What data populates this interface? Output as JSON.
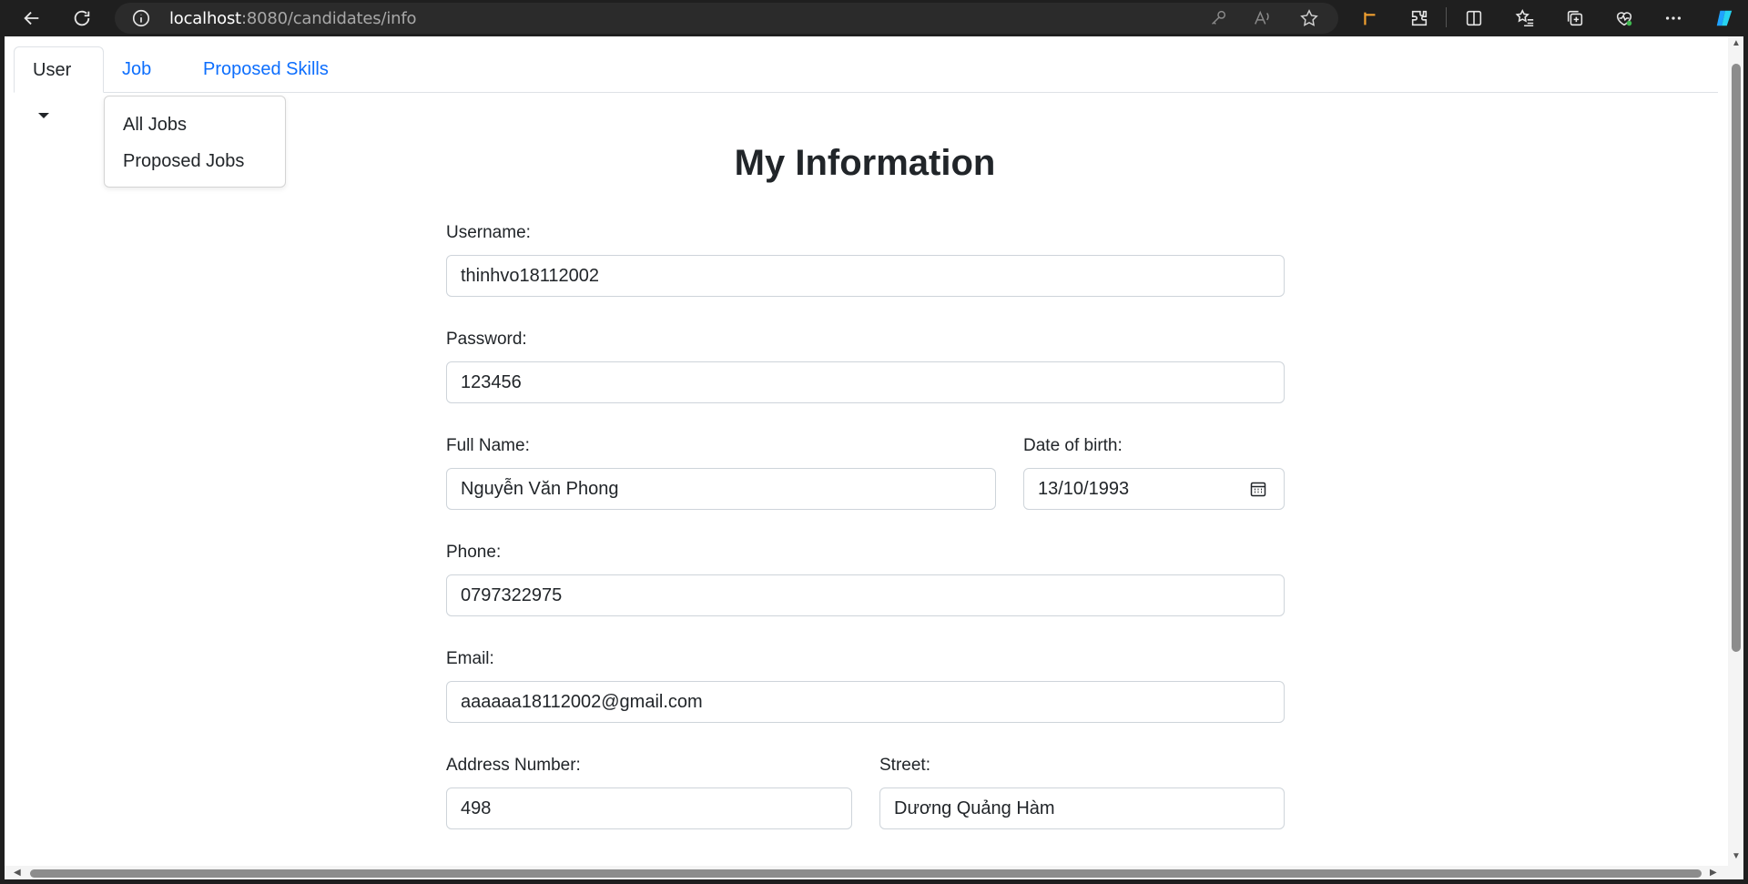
{
  "browser": {
    "url_host": "localhost",
    "url_path": ":8080/candidates/info"
  },
  "nav": {
    "tabs": [
      {
        "label": "User",
        "dropdown": true,
        "active": true
      },
      {
        "label": "Job",
        "dropdown": true,
        "active": false
      },
      {
        "label": "Proposed Skills",
        "dropdown": false,
        "active": false
      }
    ],
    "job_menu": [
      "All Jobs",
      "Proposed Jobs"
    ]
  },
  "form": {
    "title": "My Information",
    "username": {
      "label": "Username:",
      "value": "thinhvo18112002"
    },
    "password": {
      "label": "Password:",
      "value": "123456"
    },
    "full_name": {
      "label": "Full Name:",
      "value": "Nguyễn Văn Phong"
    },
    "dob": {
      "label": "Date of birth:",
      "value": "13/10/1993"
    },
    "phone": {
      "label": "Phone:",
      "value": "0797322975"
    },
    "email": {
      "label": "Email:",
      "value": "aaaaaa18112002@gmail.com"
    },
    "address_number": {
      "label": "Address Number:",
      "value": "498"
    },
    "street": {
      "label": "Street:",
      "value": "Dương Quảng Hàm"
    }
  },
  "colors": {
    "link": "#0d6efd",
    "text": "#212529",
    "border": "#ced4da",
    "chrome": "#1f1f1f"
  }
}
